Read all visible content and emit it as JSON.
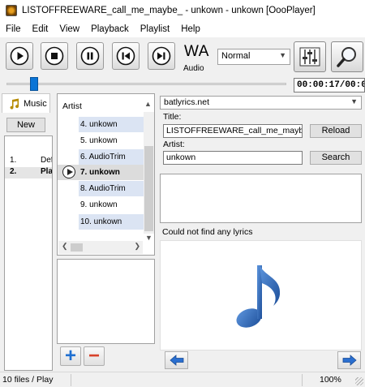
{
  "window": {
    "title": "LISTOFFREEWARE_call_me_maybe_ - unkown - unkown [OooPlayer]"
  },
  "menu": [
    "File",
    "Edit",
    "View",
    "Playback",
    "Playlist",
    "Help"
  ],
  "toolbar": {
    "track_title_partial": "WA",
    "track_info_partial": "Audio la",
    "mode_value": "Normal",
    "time_display": "00:00:17/00:0",
    "seek_progress_fraction": 0.1
  },
  "sidebar": {
    "tab_label": "Music",
    "new_button_label": "New",
    "playlists": [
      {
        "num": "1.",
        "name": "Def",
        "selected": false
      },
      {
        "num": "2.",
        "name": "Pla",
        "selected": true
      }
    ]
  },
  "artist_panel": {
    "header": "Artist",
    "items": [
      "4. unkown",
      "5. unkown",
      "6. AudioTrim",
      "7. unkown",
      "8. AudioTrim",
      "9. unkown",
      "10. unkown"
    ],
    "current_index": 3
  },
  "lyrics": {
    "source_value": "batlyrics.net",
    "title_label": "Title:",
    "title_value": "LISTOFFREEWARE_call_me_maybe_",
    "reload_label": "Reload",
    "artist_label": "Artist:",
    "artist_value": "unkown",
    "search_label": "Search",
    "status_text": "Could not find any lyrics"
  },
  "status": {
    "left": "10 files / Play",
    "right": "100%"
  },
  "colors": {
    "accent": "#0a74d6",
    "music_note": "#1d5aa8",
    "list_alt": "#dbe4f3"
  }
}
